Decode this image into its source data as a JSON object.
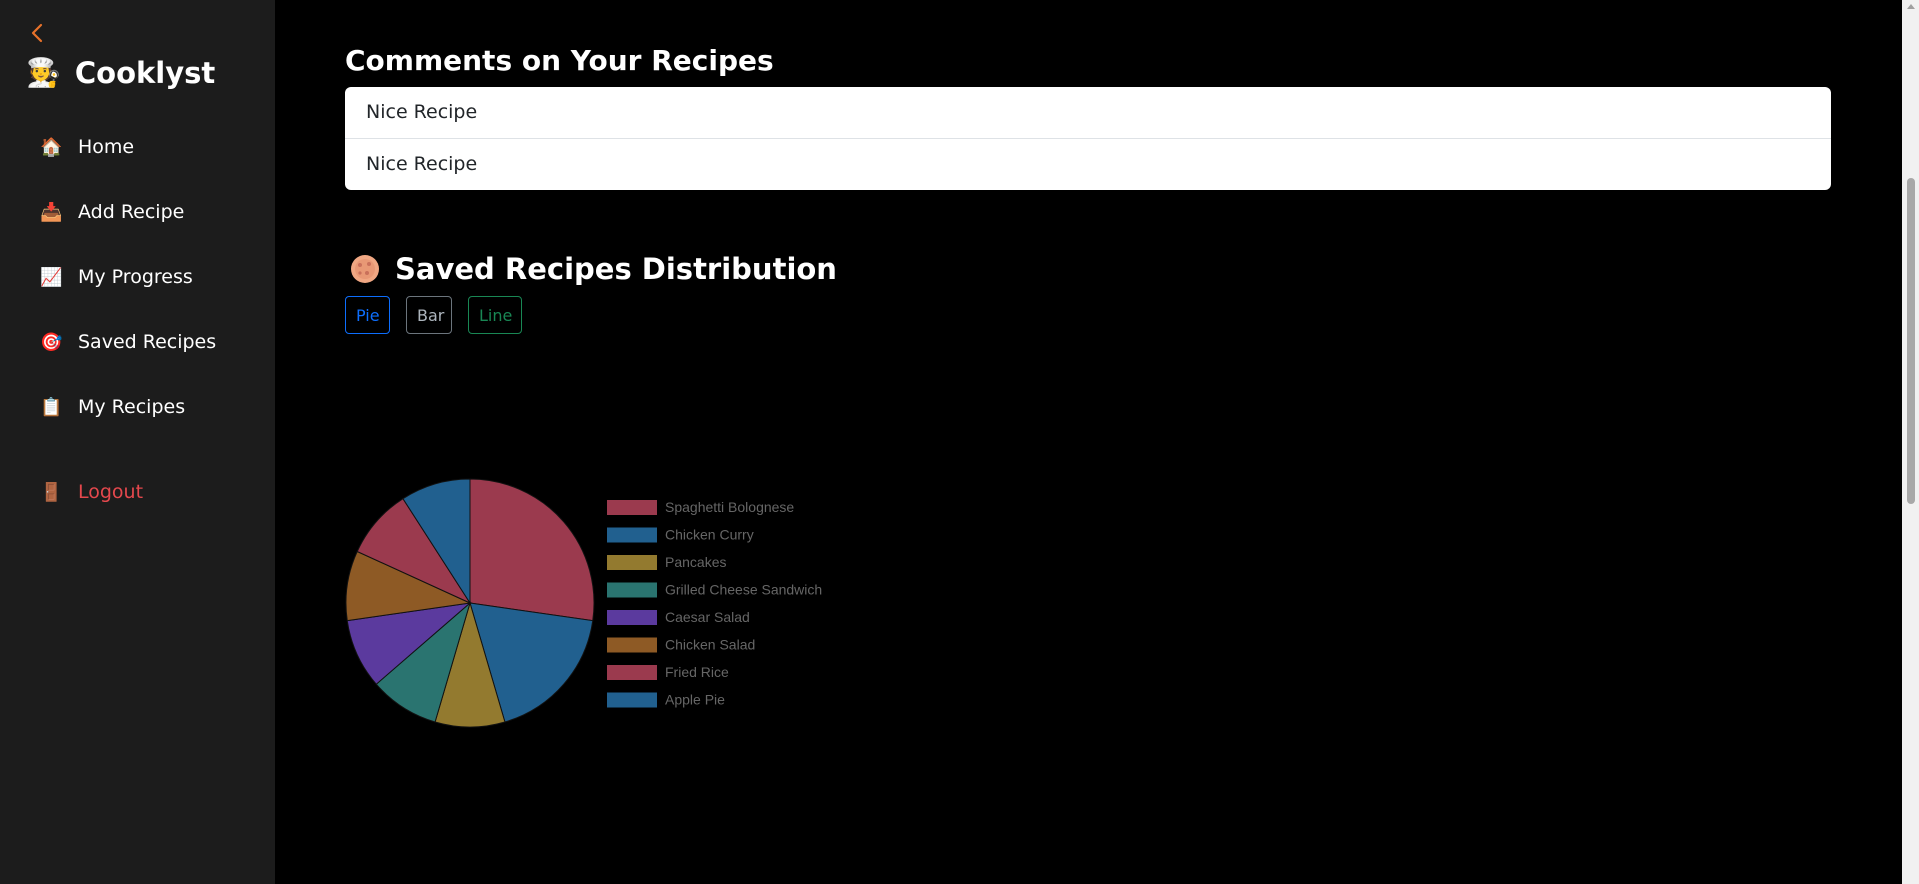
{
  "sidebar": {
    "brand": "Cooklyst",
    "items": [
      {
        "label": "Home",
        "icon": "house-icon",
        "glyph": "🏠"
      },
      {
        "label": "Add Recipe",
        "icon": "inbox-tray-icon",
        "glyph": "📥"
      },
      {
        "label": "My Progress",
        "icon": "chart-increasing-icon",
        "glyph": "📈"
      },
      {
        "label": "Saved Recipes",
        "icon": "target-icon",
        "glyph": "🎯"
      },
      {
        "label": "My Recipes",
        "icon": "clipboard-icon",
        "glyph": "📋"
      }
    ],
    "logout": {
      "label": "Logout",
      "icon": "door-icon",
      "glyph": "🚪"
    }
  },
  "comments": {
    "title": "Comments on Your Recipes",
    "items": [
      "Nice Recipe",
      "Nice Recipe"
    ]
  },
  "distribution": {
    "title": "Saved Recipes Distribution",
    "buttons": [
      {
        "label": "Pie",
        "color": "#0d6efd"
      },
      {
        "label": "Bar",
        "color": "#6c757d"
      },
      {
        "label": "Line",
        "color": "#198754"
      }
    ]
  },
  "chart_data": {
    "type": "pie",
    "categories": [
      "Spaghetti Bolognese",
      "Chicken Curry",
      "Pancakes",
      "Grilled Cheese Sandwich",
      "Caesar Salad",
      "Chicken Salad",
      "Fried Rice",
      "Apple Pie"
    ],
    "values": [
      3,
      2,
      1,
      1,
      1,
      1,
      1,
      1
    ],
    "colors": [
      "#9b3a4e",
      "#21608f",
      "#937a2f",
      "#2a7470",
      "#5b3a9e",
      "#8e5a25",
      "#9b3a4e",
      "#21608f"
    ],
    "legend_position": "right"
  }
}
